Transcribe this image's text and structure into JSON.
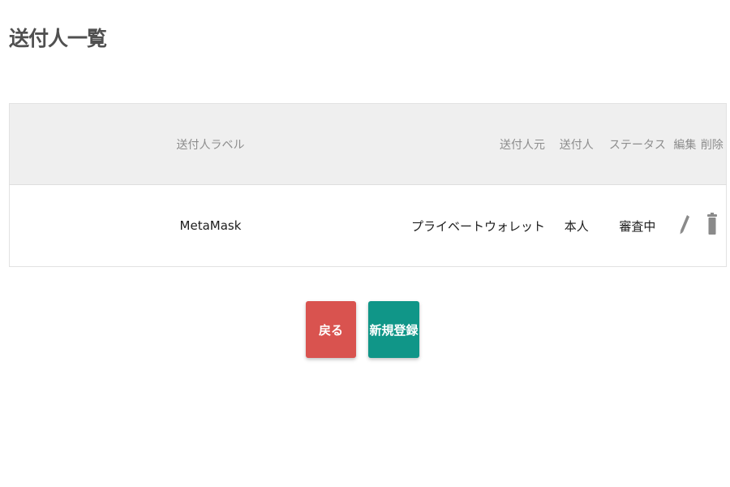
{
  "page": {
    "title": "送付人一覧"
  },
  "table": {
    "headers": {
      "label": "送付人ラベル",
      "source": "送付人元",
      "sender": "送付人",
      "status": "ステータス",
      "edit": "編集",
      "delete": "削除"
    },
    "rows": [
      {
        "label": "MetaMask",
        "source": "プライベートウォレット",
        "sender": "本人",
        "status": "審査中",
        "edit_icon": "pencil-icon",
        "delete_icon": "trash-icon"
      }
    ]
  },
  "buttons": {
    "back_label": "戻る",
    "back_color": "#d9534f",
    "new_label": "新規登録",
    "new_color": "#109688"
  }
}
